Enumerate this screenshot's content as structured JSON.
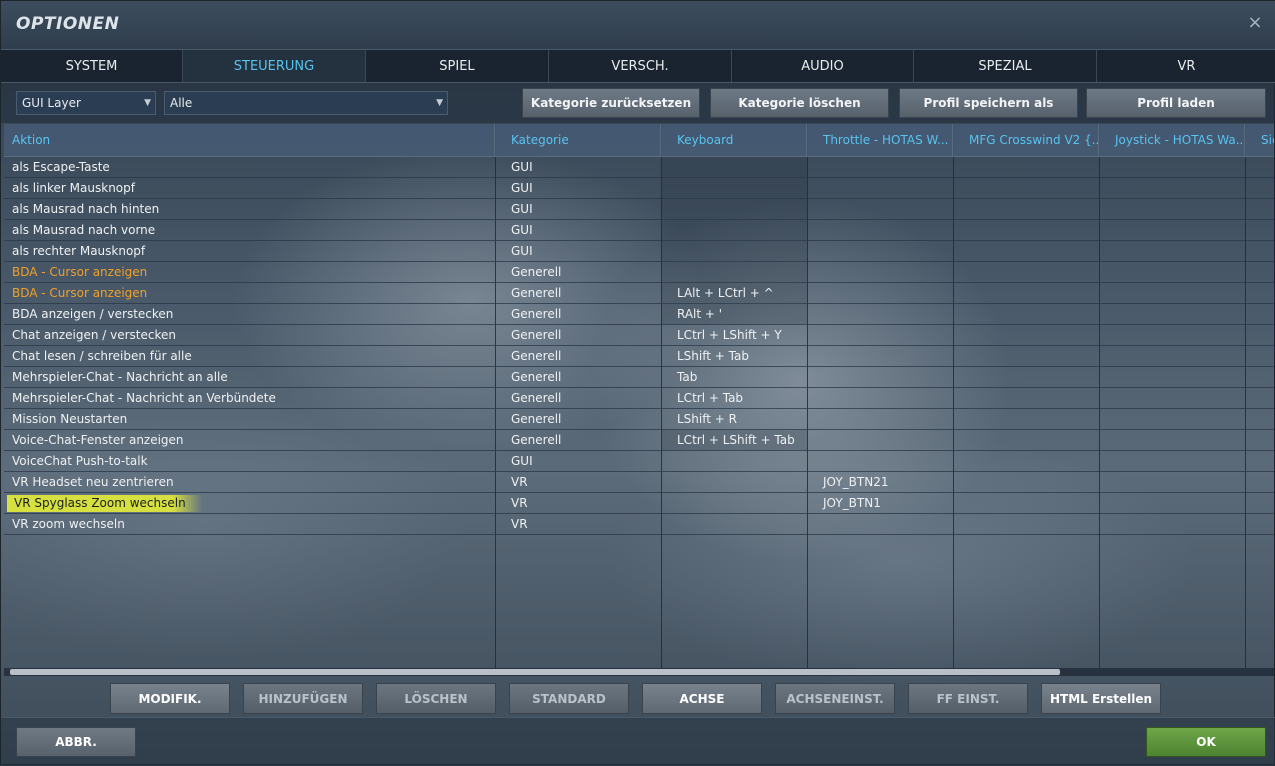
{
  "window": {
    "title": "OPTIONEN",
    "close_icon": "×"
  },
  "tabs": [
    {
      "label": "SYSTEM",
      "active": false
    },
    {
      "label": "STEUERUNG",
      "active": true
    },
    {
      "label": "SPIEL",
      "active": false
    },
    {
      "label": "VERSCH.",
      "active": false
    },
    {
      "label": "AUDIO",
      "active": false
    },
    {
      "label": "SPEZIAL",
      "active": false
    },
    {
      "label": "VR",
      "active": false
    }
  ],
  "toolbar": {
    "layer_select": "GUI Layer",
    "category_select": "Alle",
    "reset_category": "Kategorie zurücksetzen",
    "delete_category": "Kategorie löschen",
    "save_profile": "Profil speichern als",
    "load_profile": "Profil laden"
  },
  "table": {
    "headers": [
      "Aktion",
      "Kategorie",
      "Keyboard",
      "Throttle - HOTAS W...",
      "MFG Crosswind V2 {...",
      "Joystick - HOTAS Wa...",
      "Sic"
    ],
    "rows": [
      {
        "aktion": "als Escape-Taste",
        "kategorie": "GUI",
        "keyboard": "",
        "throttle": "",
        "style": ""
      },
      {
        "aktion": "als linker Mausknopf",
        "kategorie": "GUI",
        "keyboard": "",
        "throttle": "",
        "style": ""
      },
      {
        "aktion": "als Mausrad nach hinten",
        "kategorie": "GUI",
        "keyboard": "",
        "throttle": "",
        "style": ""
      },
      {
        "aktion": "als Mausrad nach vorne",
        "kategorie": "GUI",
        "keyboard": "",
        "throttle": "",
        "style": ""
      },
      {
        "aktion": "als rechter Mausknopf",
        "kategorie": "GUI",
        "keyboard": "",
        "throttle": "",
        "style": ""
      },
      {
        "aktion": "BDA - Cursor anzeigen",
        "kategorie": "Generell",
        "keyboard": "",
        "throttle": "",
        "style": "orange"
      },
      {
        "aktion": "BDA - Cursor anzeigen",
        "kategorie": "Generell",
        "keyboard": "LAlt + LCtrl + ^",
        "throttle": "",
        "style": "orange"
      },
      {
        "aktion": "BDA anzeigen / verstecken",
        "kategorie": "Generell",
        "keyboard": "RAlt + '",
        "throttle": "",
        "style": ""
      },
      {
        "aktion": "Chat anzeigen / verstecken",
        "kategorie": "Generell",
        "keyboard": "LCtrl + LShift + Y",
        "throttle": "",
        "style": ""
      },
      {
        "aktion": "Chat lesen / schreiben für alle",
        "kategorie": "Generell",
        "keyboard": "LShift + Tab",
        "throttle": "",
        "style": ""
      },
      {
        "aktion": "Mehrspieler-Chat - Nachricht an alle",
        "kategorie": "Generell",
        "keyboard": "Tab",
        "throttle": "",
        "style": ""
      },
      {
        "aktion": "Mehrspieler-Chat - Nachricht an Verbündete",
        "kategorie": "Generell",
        "keyboard": "LCtrl + Tab",
        "throttle": "",
        "style": ""
      },
      {
        "aktion": "Mission Neustarten",
        "kategorie": "Generell",
        "keyboard": "LShift + R",
        "throttle": "",
        "style": ""
      },
      {
        "aktion": "Voice-Chat-Fenster anzeigen",
        "kategorie": "Generell",
        "keyboard": "LCtrl + LShift + Tab",
        "throttle": "",
        "style": ""
      },
      {
        "aktion": "VoiceChat Push-to-talk",
        "kategorie": "GUI",
        "keyboard": "",
        "throttle": "",
        "style": ""
      },
      {
        "aktion": "VR Headset neu zentrieren",
        "kategorie": "VR",
        "keyboard": "",
        "throttle": "JOY_BTN21",
        "style": ""
      },
      {
        "aktion": "VR Spyglass Zoom wechseln",
        "kategorie": "VR",
        "keyboard": "",
        "throttle": "JOY_BTN1",
        "style": "highlight"
      },
      {
        "aktion": "VR zoom wechseln",
        "kategorie": "VR",
        "keyboard": "",
        "throttle": "",
        "style": ""
      }
    ]
  },
  "bottom_buttons": [
    "MODIFIK.",
    "HINZUFÜGEN",
    "LÖSCHEN",
    "STANDARD",
    "ACHSE",
    "ACHSENEINST.",
    "FF EINST.",
    "HTML Erstellen"
  ],
  "footer": {
    "cancel": "ABBR.",
    "ok": "OK"
  },
  "colors": {
    "accent": "#58c3ef",
    "orange": "#f0a028",
    "highlight": "#e8ee48",
    "ok_green": "#5f9a3d"
  }
}
